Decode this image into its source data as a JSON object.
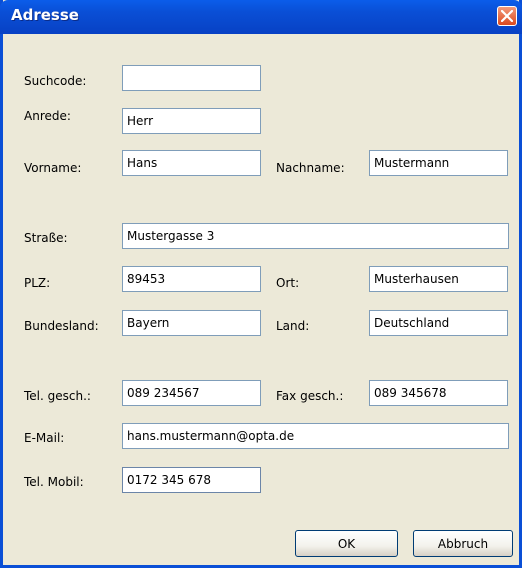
{
  "window": {
    "title": "Adresse"
  },
  "labels": {
    "suchcode": "Suchcode:",
    "anrede": "Anrede:",
    "vorname": "Vorname:",
    "nachname": "Nachname:",
    "strasse": "Straße:",
    "plz": "PLZ:",
    "ort": "Ort:",
    "bundesland": "Bundesland:",
    "land": "Land:",
    "tel_gesch": "Tel. gesch.:",
    "fax_gesch": "Fax gesch.:",
    "email": "E-Mail:",
    "tel_mobil": "Tel. Mobil:"
  },
  "values": {
    "suchcode": "",
    "anrede": "Herr",
    "vorname": "Hans",
    "nachname": "Mustermann",
    "strasse": "Mustergasse 3",
    "plz": "89453",
    "ort": "Musterhausen",
    "bundesland": "Bayern",
    "land": "Deutschland",
    "tel_gesch": "089 234567",
    "fax_gesch": "089 345678",
    "email": "hans.mustermann@opta.de",
    "tel_mobil": "0172 345 678"
  },
  "buttons": {
    "ok": "OK",
    "cancel": "Abbruch"
  },
  "icons": {
    "close": "close-icon"
  },
  "colors": {
    "titlebar": "#0a4fd6",
    "background": "#ece9d8",
    "close": "#dd4a1e",
    "field_border": "#7f9db9"
  }
}
